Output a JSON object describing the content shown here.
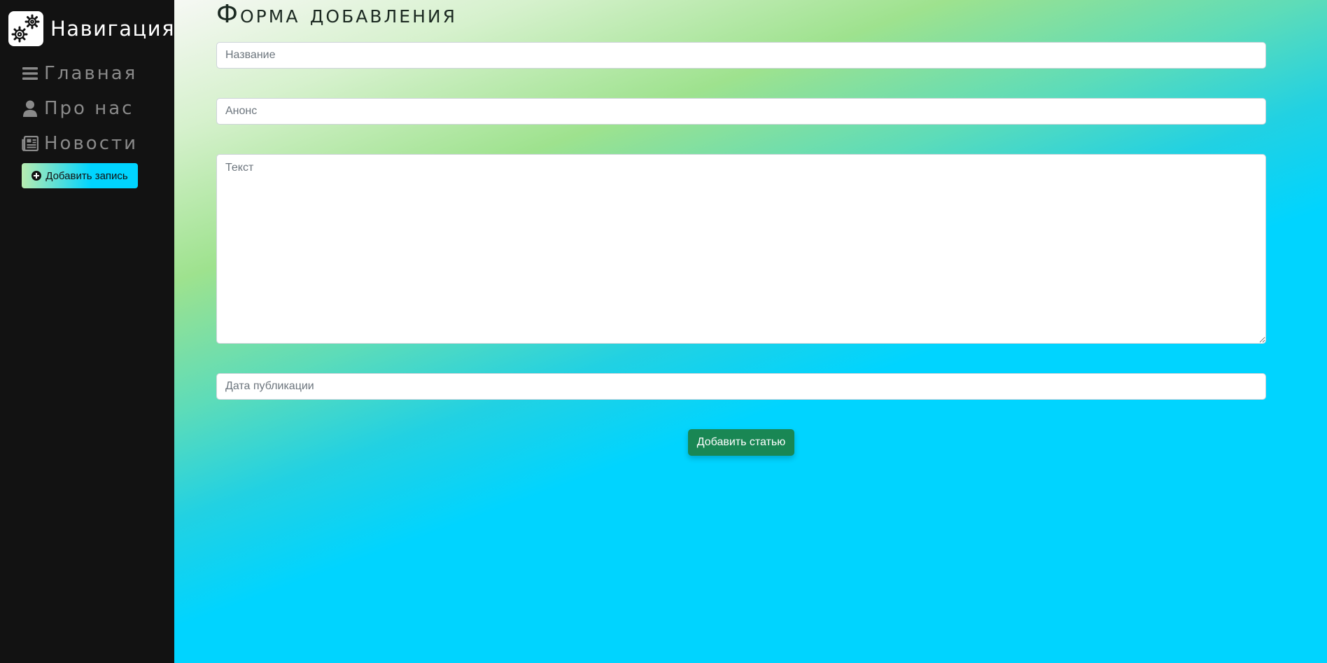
{
  "sidebar": {
    "brand": {
      "title": "Навигация",
      "icon": "gears-icon"
    },
    "nav": [
      {
        "label": "Главная",
        "icon": "bars-icon"
      },
      {
        "label": "Про нас",
        "icon": "user-icon"
      },
      {
        "label": "Новости",
        "icon": "newspaper-icon"
      }
    ],
    "add_record": {
      "label": "Добавить запись",
      "icon": "plus-circle-icon"
    }
  },
  "main": {
    "title": "Форма добавления",
    "fields": {
      "title_placeholder": "Название",
      "anons_placeholder": "Анонс",
      "text_placeholder": "Текст",
      "date_placeholder": "Дата публикации"
    },
    "submit_label": "Добавить статью"
  },
  "colors": {
    "sidebar_bg": "#121212",
    "accent_cyan": "#00d4ff",
    "accent_green": "#9ee28e",
    "submit_bg": "#198754"
  }
}
